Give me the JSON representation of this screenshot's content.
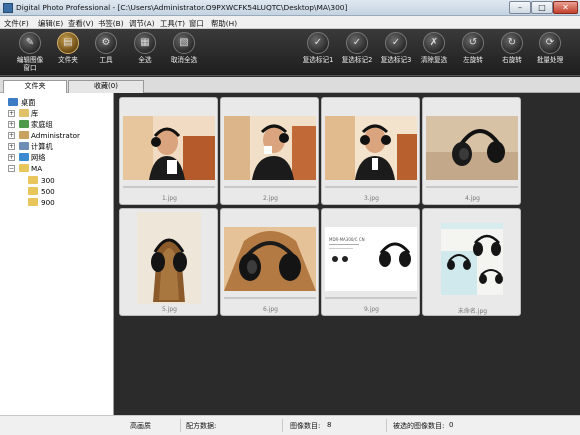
{
  "window": {
    "title": "Digital Photo Professional - [C:\\Users\\Administrator.O9PXWCFK54LUQTC\\Desktop\\MA\\300]",
    "min_glyph": "–",
    "max_glyph": "□",
    "close_glyph": "✕"
  },
  "menu": [
    "文件(F)",
    "编辑(E)",
    "查看(V)",
    "书签(B)",
    "调节(A)",
    "工具(T)",
    "窗口",
    "帮助(H)"
  ],
  "toolbar": {
    "left": [
      {
        "label": "编辑图像",
        "label2": "窗口",
        "icon": "edit-image-window-icon",
        "glyph": "✎"
      },
      {
        "label": "文件夹",
        "label2": "",
        "icon": "folder-icon",
        "glyph": "▤"
      },
      {
        "label": "工具",
        "label2": "",
        "icon": "tools-icon",
        "glyph": "⚙"
      },
      {
        "label": "全选",
        "label2": "",
        "icon": "select-all-icon",
        "glyph": "▦"
      },
      {
        "label": "取消全选",
        "label2": "",
        "icon": "deselect-all-icon",
        "glyph": "▧"
      }
    ],
    "right": [
      {
        "label": "复选标记1",
        "icon": "check-mark-1-icon",
        "glyph": "✓"
      },
      {
        "label": "复选标记2",
        "icon": "check-mark-2-icon",
        "glyph": "✓"
      },
      {
        "label": "复选标记3",
        "icon": "check-mark-3-icon",
        "glyph": "✓"
      },
      {
        "label": "清除复选",
        "icon": "clear-check-icon",
        "glyph": "✗"
      },
      {
        "label": "左旋转",
        "icon": "rotate-left-icon",
        "glyph": "↺"
      },
      {
        "label": "右旋转",
        "icon": "rotate-right-icon",
        "glyph": "↻"
      },
      {
        "label": "批量处理",
        "icon": "batch-process-icon",
        "glyph": "⟳"
      }
    ]
  },
  "tabs": [
    {
      "label": "文件夹",
      "selected": true
    },
    {
      "label": "收藏(0)",
      "selected": false
    }
  ],
  "tree": [
    {
      "label": "桌面",
      "icon": "desktop-icon",
      "expander": "",
      "level": 0
    },
    {
      "label": "库",
      "icon": "library-icon",
      "expander": "+",
      "level": 1
    },
    {
      "label": "家庭组",
      "icon": "homegroup-icon",
      "expander": "+",
      "level": 1
    },
    {
      "label": "Administrator",
      "icon": "user-folder-icon",
      "expander": "+",
      "level": 1
    },
    {
      "label": "计算机",
      "icon": "computer-icon",
      "expander": "+",
      "level": 1
    },
    {
      "label": "网络",
      "icon": "network-icon",
      "expander": "+",
      "level": 1
    },
    {
      "label": "MA",
      "icon": "folder-icon",
      "expander": "−",
      "level": 1
    },
    {
      "label": "300",
      "icon": "folder-icon",
      "expander": "",
      "level": 2
    },
    {
      "label": "500",
      "icon": "folder-icon",
      "expander": "",
      "level": 2
    },
    {
      "label": "900",
      "icon": "folder-icon",
      "expander": "",
      "level": 2
    }
  ],
  "thumbnails": [
    {
      "name": "1.jpg",
      "kind": "land",
      "scene": "man-headphones"
    },
    {
      "name": "2.jpg",
      "kind": "land",
      "scene": "man-drinking"
    },
    {
      "name": "3.jpg",
      "kind": "land",
      "scene": "man-headphones-2"
    },
    {
      "name": "4.jpg",
      "kind": "land",
      "scene": "headphones-dark"
    },
    {
      "name": "5.jpg",
      "kind": "port",
      "scene": "headphones-stand"
    },
    {
      "name": "6.jpg",
      "kind": "land",
      "scene": "headphones-closeup"
    },
    {
      "name": "9.jpg",
      "kind": "land",
      "scene": "product-sheet"
    },
    {
      "name": "未命名.jpg",
      "kind": "sq",
      "scene": "product-ad"
    }
  ],
  "thumbnail_texts": {
    "sheet_title": "MDR-MA300/C CN"
  },
  "status": {
    "quality": "高画质",
    "recipe_label": "配方数据:",
    "recipe_value": "",
    "image_count_label": "图像数目:",
    "image_count": "8",
    "selected_count_label": "被选的图像数目:",
    "selected_count": "0"
  },
  "colors": {
    "toolbar_bg": "#262626",
    "thumb_area_bg": "#2b2b2b",
    "active_button": "#c8a050"
  }
}
